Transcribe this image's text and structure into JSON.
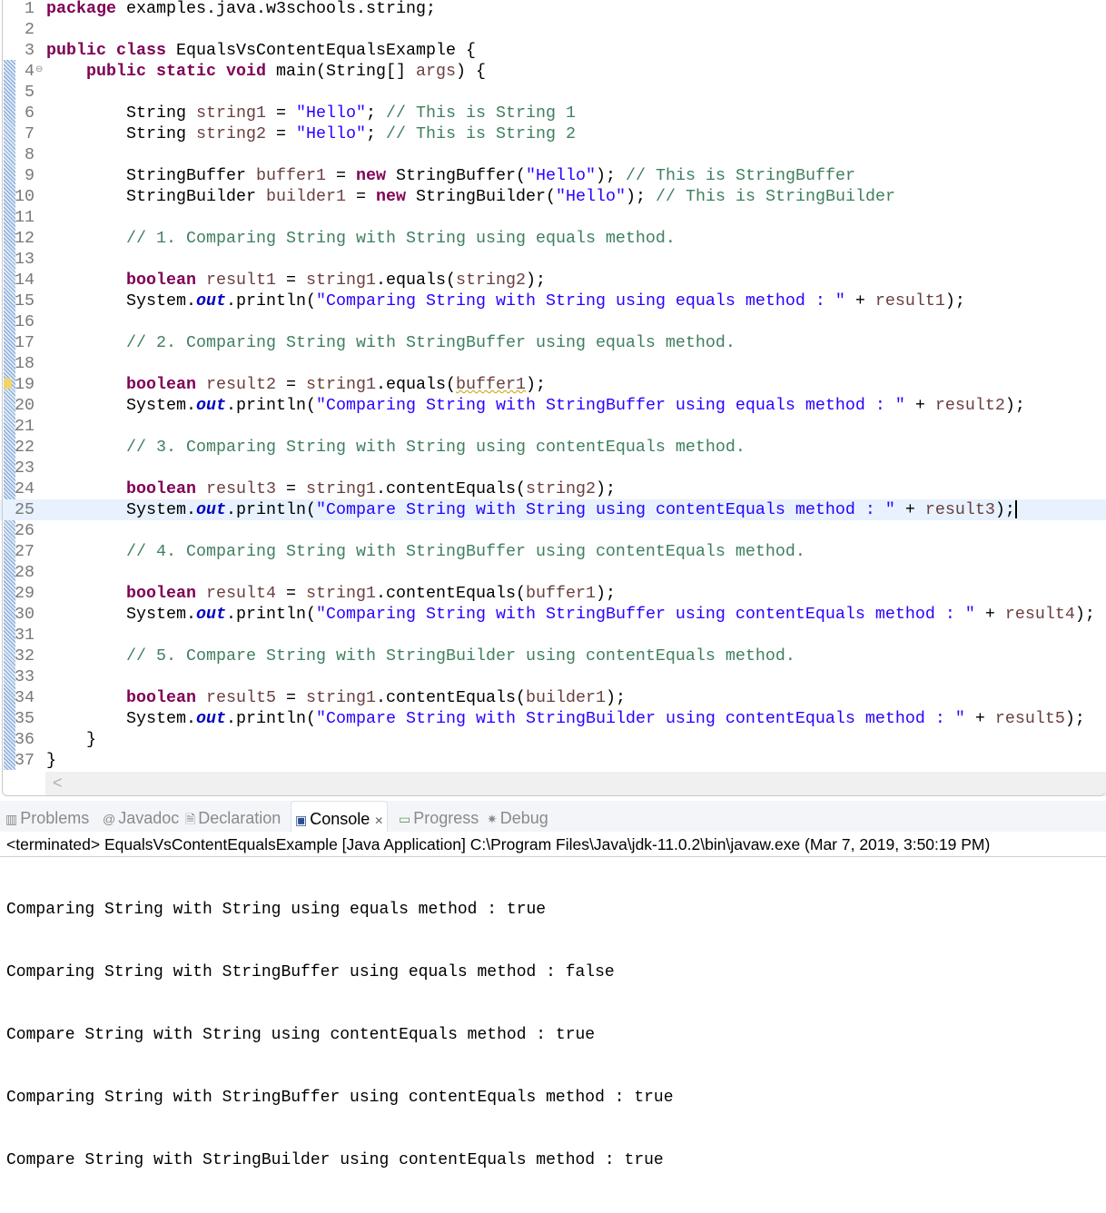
{
  "editor": {
    "lines": [
      [
        [
          "k",
          "package"
        ],
        [
          "t",
          " examples.java.w3schools.string;"
        ]
      ],
      [],
      [
        [
          "k",
          "public"
        ],
        [
          "t",
          " "
        ],
        [
          "k",
          "class"
        ],
        [
          "t",
          " EqualsVsContentEqualsExample {"
        ]
      ],
      [
        [
          "t",
          "    "
        ],
        [
          "k",
          "public"
        ],
        [
          "t",
          " "
        ],
        [
          "k",
          "static"
        ],
        [
          "t",
          " "
        ],
        [
          "k",
          "void"
        ],
        [
          "t",
          " main(String[] "
        ],
        [
          "v",
          "args"
        ],
        [
          "t",
          ") {"
        ]
      ],
      [],
      [
        [
          "t",
          "        String "
        ],
        [
          "v",
          "string1"
        ],
        [
          "t",
          " = "
        ],
        [
          "s",
          "\"Hello\""
        ],
        [
          "t",
          "; "
        ],
        [
          "c",
          "// This is String 1"
        ]
      ],
      [
        [
          "t",
          "        String "
        ],
        [
          "v",
          "string2"
        ],
        [
          "t",
          " = "
        ],
        [
          "s",
          "\"Hello\""
        ],
        [
          "t",
          "; "
        ],
        [
          "c",
          "// This is String 2"
        ]
      ],
      [],
      [
        [
          "t",
          "        StringBuffer "
        ],
        [
          "v",
          "buffer1"
        ],
        [
          "t",
          " = "
        ],
        [
          "k",
          "new"
        ],
        [
          "t",
          " StringBuffer("
        ],
        [
          "s",
          "\"Hello\""
        ],
        [
          "t",
          "); "
        ],
        [
          "c",
          "// This is StringBuffer"
        ]
      ],
      [
        [
          "t",
          "        StringBuilder "
        ],
        [
          "v",
          "builder1"
        ],
        [
          "t",
          " = "
        ],
        [
          "k",
          "new"
        ],
        [
          "t",
          " StringBuilder("
        ],
        [
          "s",
          "\"Hello\""
        ],
        [
          "t",
          "); "
        ],
        [
          "c",
          "// This is StringBuilder"
        ]
      ],
      [],
      [
        [
          "t",
          "        "
        ],
        [
          "c",
          "// 1. Comparing String with String using equals method."
        ]
      ],
      [],
      [
        [
          "t",
          "        "
        ],
        [
          "k",
          "boolean"
        ],
        [
          "t",
          " "
        ],
        [
          "v",
          "result1"
        ],
        [
          "t",
          " = "
        ],
        [
          "v",
          "string1"
        ],
        [
          "t",
          ".equals("
        ],
        [
          "v",
          "string2"
        ],
        [
          "t",
          ");"
        ]
      ],
      [
        [
          "t",
          "        System."
        ],
        [
          "f",
          "out"
        ],
        [
          "t",
          ".println("
        ],
        [
          "s",
          "\"Comparing String with String using equals method : \""
        ],
        [
          "t",
          " + "
        ],
        [
          "v",
          "result1"
        ],
        [
          "t",
          ");"
        ]
      ],
      [],
      [
        [
          "t",
          "        "
        ],
        [
          "c",
          "// 2. Comparing String with StringBuffer using equals method."
        ]
      ],
      [],
      [
        [
          "t",
          "        "
        ],
        [
          "k",
          "boolean"
        ],
        [
          "t",
          " "
        ],
        [
          "v",
          "result2"
        ],
        [
          "t",
          " = "
        ],
        [
          "v",
          "string1"
        ],
        [
          "t",
          ".equals("
        ],
        [
          "vw",
          "buffer1"
        ],
        [
          "t",
          ");"
        ]
      ],
      [
        [
          "t",
          "        System."
        ],
        [
          "f",
          "out"
        ],
        [
          "t",
          ".println("
        ],
        [
          "s",
          "\"Comparing String with StringBuffer using equals method : \""
        ],
        [
          "t",
          " + "
        ],
        [
          "v",
          "result2"
        ],
        [
          "t",
          ");"
        ]
      ],
      [],
      [
        [
          "t",
          "        "
        ],
        [
          "c",
          "// 3. Comparing String with String using contentEquals method."
        ]
      ],
      [],
      [
        [
          "t",
          "        "
        ],
        [
          "k",
          "boolean"
        ],
        [
          "t",
          " "
        ],
        [
          "v",
          "result3"
        ],
        [
          "t",
          " = "
        ],
        [
          "v",
          "string1"
        ],
        [
          "t",
          ".contentEquals("
        ],
        [
          "v",
          "string2"
        ],
        [
          "t",
          ");"
        ]
      ],
      [
        [
          "t",
          "        System."
        ],
        [
          "f",
          "out"
        ],
        [
          "t",
          ".println("
        ],
        [
          "s",
          "\"Compare String with String using contentEquals method : \""
        ],
        [
          "t",
          " + "
        ],
        [
          "v",
          "result3"
        ],
        [
          "t",
          ");"
        ]
      ],
      [],
      [
        [
          "t",
          "        "
        ],
        [
          "c",
          "// 4. Comparing String with StringBuffer using contentEquals method."
        ]
      ],
      [],
      [
        [
          "t",
          "        "
        ],
        [
          "k",
          "boolean"
        ],
        [
          "t",
          " "
        ],
        [
          "v",
          "result4"
        ],
        [
          "t",
          " = "
        ],
        [
          "v",
          "string1"
        ],
        [
          "t",
          ".contentEquals("
        ],
        [
          "v",
          "buffer1"
        ],
        [
          "t",
          ");"
        ]
      ],
      [
        [
          "t",
          "        System."
        ],
        [
          "f",
          "out"
        ],
        [
          "t",
          ".println("
        ],
        [
          "s",
          "\"Comparing String with StringBuffer using contentEquals method : \""
        ],
        [
          "t",
          " + "
        ],
        [
          "v",
          "result4"
        ],
        [
          "t",
          ");"
        ]
      ],
      [],
      [
        [
          "t",
          "        "
        ],
        [
          "c",
          "// 5. Compare String with StringBuilder using contentEquals method."
        ]
      ],
      [],
      [
        [
          "t",
          "        "
        ],
        [
          "k",
          "boolean"
        ],
        [
          "t",
          " "
        ],
        [
          "v",
          "result5"
        ],
        [
          "t",
          " = "
        ],
        [
          "v",
          "string1"
        ],
        [
          "t",
          ".contentEquals("
        ],
        [
          "v",
          "builder1"
        ],
        [
          "t",
          ");"
        ]
      ],
      [
        [
          "t",
          "        System."
        ],
        [
          "f",
          "out"
        ],
        [
          "t",
          ".println("
        ],
        [
          "s",
          "\"Compare String with StringBuilder using contentEquals method : \""
        ],
        [
          "t",
          " + "
        ],
        [
          "v",
          "result5"
        ],
        [
          "t",
          ");"
        ]
      ],
      [
        [
          "t",
          "    }"
        ]
      ],
      [
        [
          "t",
          "}"
        ]
      ]
    ],
    "current_line": 25,
    "warning_line": 19,
    "fold_line": 4,
    "colors": {
      "keyword": "#7f0055",
      "string": "#2a00ff",
      "comment": "#3f7f5f",
      "local_var": "#6a3e3e",
      "field": "#0000c0",
      "current_line_bg": "#e8f2fe"
    }
  },
  "tabs": [
    {
      "label": "Problems",
      "icon": "problems-icon"
    },
    {
      "label": "Javadoc",
      "icon": "javadoc-icon"
    },
    {
      "label": "Declaration",
      "icon": "declaration-icon"
    },
    {
      "label": "Console",
      "icon": "console-icon",
      "active": true
    },
    {
      "label": "Progress",
      "icon": "progress-icon"
    },
    {
      "label": "Debug",
      "icon": "debug-icon"
    }
  ],
  "console": {
    "status": "<terminated> EqualsVsContentEqualsExample [Java Application] C:\\Program Files\\Java\\jdk-11.0.2\\bin\\javaw.exe (Mar 7, 2019, 3:50:19 PM)",
    "output": [
      "Comparing String with String using equals method : true",
      "Comparing String with StringBuffer using equals method : false",
      "Compare String with String using contentEquals method : true",
      "Comparing String with StringBuffer using contentEquals method : true",
      "Compare String with StringBuilder using contentEquals method : true"
    ]
  },
  "scroll_left_glyph": "<"
}
